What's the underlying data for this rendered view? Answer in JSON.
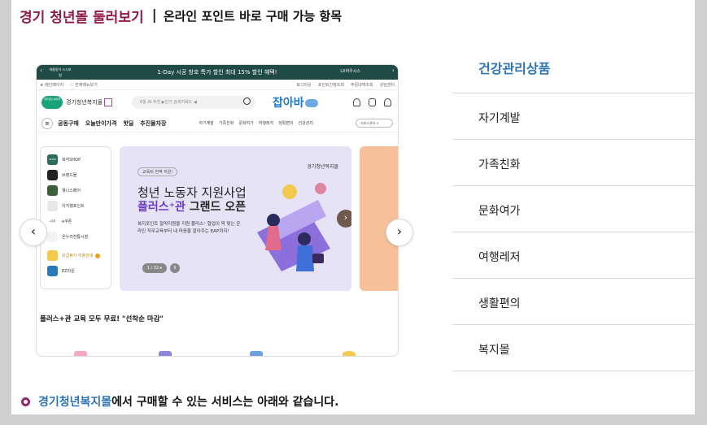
{
  "header": {
    "title": "경기 청년몰 둘러보기",
    "separator": "|",
    "subtitle": "온라인 포인트 바로 구매 가능 항목"
  },
  "carousel": {
    "prev_label": "‹",
    "next_label": "›",
    "slide": {
      "promo_banner": {
        "badge": "여름맞이 스시포럼",
        "text": "1-Day 시공 창호 특가 할인  최대 15% 할인 혜택!",
        "brand": "LX하우시스",
        "prev": "‹",
        "next": "›"
      },
      "util_bar": {
        "left": [
          "★ 메인페이지",
          "☆ 전체메뉴보기"
        ],
        "right": [
          "로그아웃",
          "포인트간행조회",
          "주문내역조회",
          "상담센터"
        ]
      },
      "logo_row": {
        "gg_logo_text": "경기청년 복지몰",
        "site_name": "경기청년복지몰",
        "search_placeholder": "6월 AI 추천 ▶인기 검색키워드 ◀",
        "job_logo": "잡아바",
        "job_logo_badge": "Youth"
      },
      "nav_row": {
        "menu_icon": "≡",
        "main": [
          "공동구매",
          "오늘만이가격",
          "핫딜",
          "추진몰차장"
        ],
        "sub": [
          "자기계발",
          "가족친화",
          "문화여가",
          "여행레저",
          "생활편의",
          "건강관리"
        ],
        "service_select": "서비스관리 ∨"
      },
      "side_menu": [
        {
          "label": "복지SHOP",
          "icon_text": "SHOP"
        },
        {
          "label": "브랜드몰",
          "icon_text": ""
        },
        {
          "label": "웰니스페어",
          "icon_text": ""
        },
        {
          "label": "이지웰포인트",
          "icon_text": ""
        },
        {
          "label": "e쿠폰",
          "icon_text": "e쿠폰"
        },
        {
          "label": "온누리전통시장",
          "icon_text": ""
        },
        {
          "label": "유급휴가 이용안내",
          "icon_text": "",
          "dot": true
        },
        {
          "label": "EZ라운",
          "icon_text": ""
        }
      ],
      "hero": {
        "tag": "교육비 전액 지원!",
        "brand": "경기청년복지몰",
        "title": "청년 노동자 지원사업",
        "subtitle_accent": "플러스⁺관",
        "subtitle_rest": " 그랜드 오픈",
        "description": "복지포인트 절약지원을 지원 플러스⁺ 협업이 딱 맞는 온라인 직무교육부터 내 마음을 알아주는 EAP까지!",
        "pager": "1 / 32 ▸",
        "pause": "II",
        "next": "›"
      },
      "caption": "플러스+관 교육 모두 무료! \"선착순 마감\""
    }
  },
  "categories": {
    "active": "건강관리상품",
    "items": [
      "자기계발",
      "가족친화",
      "문화여가",
      "여행레저",
      "생활편의",
      "복지몰"
    ]
  },
  "note": {
    "highlight": "경기청년복지몰",
    "rest": "에서 구매할 수 있는 서비스는 아래와 같습니다."
  },
  "colors": {
    "title": "#8e1a48",
    "accent_blue": "#2e74b5",
    "promo_bg": "#1f4a45",
    "hero_bg": "#e6e3f7",
    "bullet": "#8e2a6a"
  }
}
